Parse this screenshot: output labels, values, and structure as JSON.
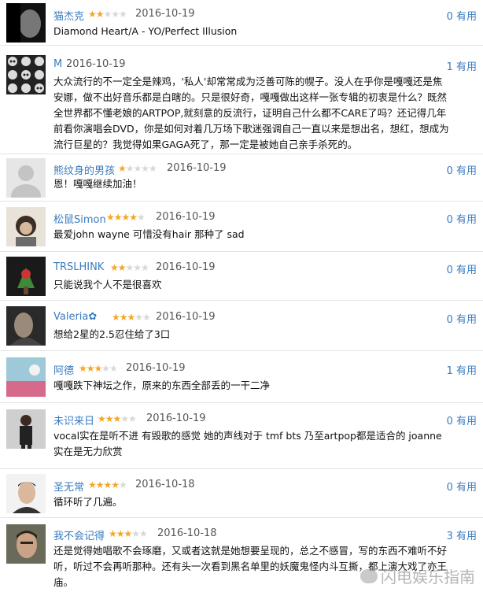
{
  "colors": {
    "name_link": "#3a7bbf",
    "star_on": "#f5a623",
    "star_off": "#d8d8d8",
    "votes": "#3a7bbf"
  },
  "reviews": [
    {
      "user": "猫杰克",
      "stars": 2,
      "date": "2016-10-19",
      "votes": "0 有用",
      "text": "Diamond Heart/A - YO/Perfect Illusion"
    },
    {
      "user": "M",
      "stars": 0,
      "date": "2016-10-19",
      "votes": "1 有用",
      "text": "大众流行的不一定全是辣鸡，'私人'却常常成为泛善可陈的幌子。没人在乎你是嘎嘎还是焦安娜，做不出好音乐都是白瞎的。只是很好奇，嘎嘎做出这样一张专辑的初衷是什么？既然全世界都不懂老娘的ARTPOP,就刻意的反流行，证明自己什么都不CARE了吗？还记得几年前看你演唱会DVD，你是如何对着几万场下歌迷强调自己一直以来是想出名，想红，想成为流行巨星的？我觉得如果GAGA死了，那一定是被她自己亲手杀死的。"
    },
    {
      "user": "熊纹身的男孩",
      "stars": 1,
      "date": "2016-10-19",
      "votes": "0 有用",
      "text": "恩！嘎嘎继续加油！"
    },
    {
      "user": "松鼠Simon",
      "stars": 4,
      "date": "2016-10-19",
      "votes": "0 有用",
      "text": "最爱john wayne 可惜没有hair 那种了 sad"
    },
    {
      "user": "TRSLHINK",
      "stars": 2,
      "date": "2016-10-19",
      "votes": "0 有用",
      "text": "只能说我个人不是很喜欢"
    },
    {
      "user": "Valeria✿",
      "stars": 3,
      "date": "2016-10-19",
      "votes": "0 有用",
      "text": "想给2星的2.5忍住给了3口"
    },
    {
      "user": "阿德",
      "stars": 3,
      "date": "2016-10-19",
      "votes": "1 有用",
      "text": "嘎嘎跌下神坛之作，原来的东西全部丢的一干二净"
    },
    {
      "user": "未识来日",
      "stars": 3,
      "date": "2016-10-19",
      "votes": "0 有用",
      "text": "vocal实在是听不进 有毁歌的感觉 她的声线对于 tmf bts 乃至artpop都是适合的 joanne实在是无力欣赏"
    },
    {
      "user": "圣无常",
      "stars": 4,
      "date": "2016-10-18",
      "votes": "0 有用",
      "text": "循环听了几遍。"
    },
    {
      "user": "我不会记得",
      "stars": 3,
      "date": "2016-10-18",
      "votes": "3 有用",
      "text": "还是觉得她唱歌不会琢磨，又或者这就是她想要呈现的，总之不感冒，写的东西不难听不好听，听过不会再听那种。还有头一次看到黑名单里的妖魔鬼怪内斗互撕，都上演大戏了亦王庙。"
    }
  ],
  "watermark": "闪电娱乐指南"
}
